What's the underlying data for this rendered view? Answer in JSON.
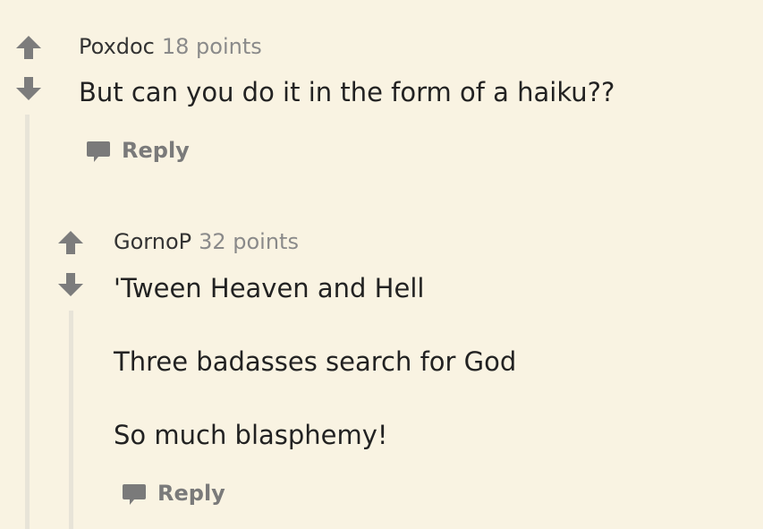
{
  "comments": [
    {
      "author": "Poxdoc",
      "points": "18 points",
      "body": [
        "But can you do it in the form of a haiku??"
      ],
      "reply_label": "Reply"
    },
    {
      "author": "GornoP",
      "points": "32 points",
      "body": [
        "'Tween Heaven and Hell",
        "Three badasses search for God",
        "So much blasphemy!"
      ],
      "reply_label": "Reply"
    }
  ],
  "icons": {
    "upvote": "arrow-up-icon",
    "downvote": "arrow-down-icon",
    "reply": "speech-bubble-icon"
  },
  "colors": {
    "background": "#f9f3e2",
    "vote_arrow": "#7c7c7c",
    "thread_line": "#e8e4d8",
    "points": "#8a8a8a",
    "reply": "#7a7a7a"
  }
}
